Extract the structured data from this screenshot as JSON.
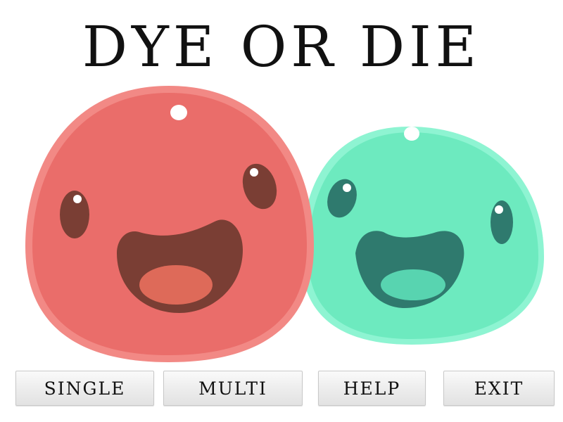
{
  "title": "DYE OR DIE",
  "menu": {
    "single_label": "SINGLE",
    "multi_label": "MULTI",
    "help_label": "HELP",
    "exit_label": "EXIT"
  },
  "colors": {
    "background": "#ffffff",
    "red_slime": "#ea6d6a",
    "red_slime_mouth": "#7a3e34",
    "red_slime_tongue": "#de6a59",
    "green_slime": "#6deabf",
    "green_slime_mouth": "#2f7a6e",
    "green_slime_tongue": "#58d4b0",
    "button_face": "#ececec"
  },
  "icons": [
    "red-slime-character",
    "green-slime-character"
  ]
}
